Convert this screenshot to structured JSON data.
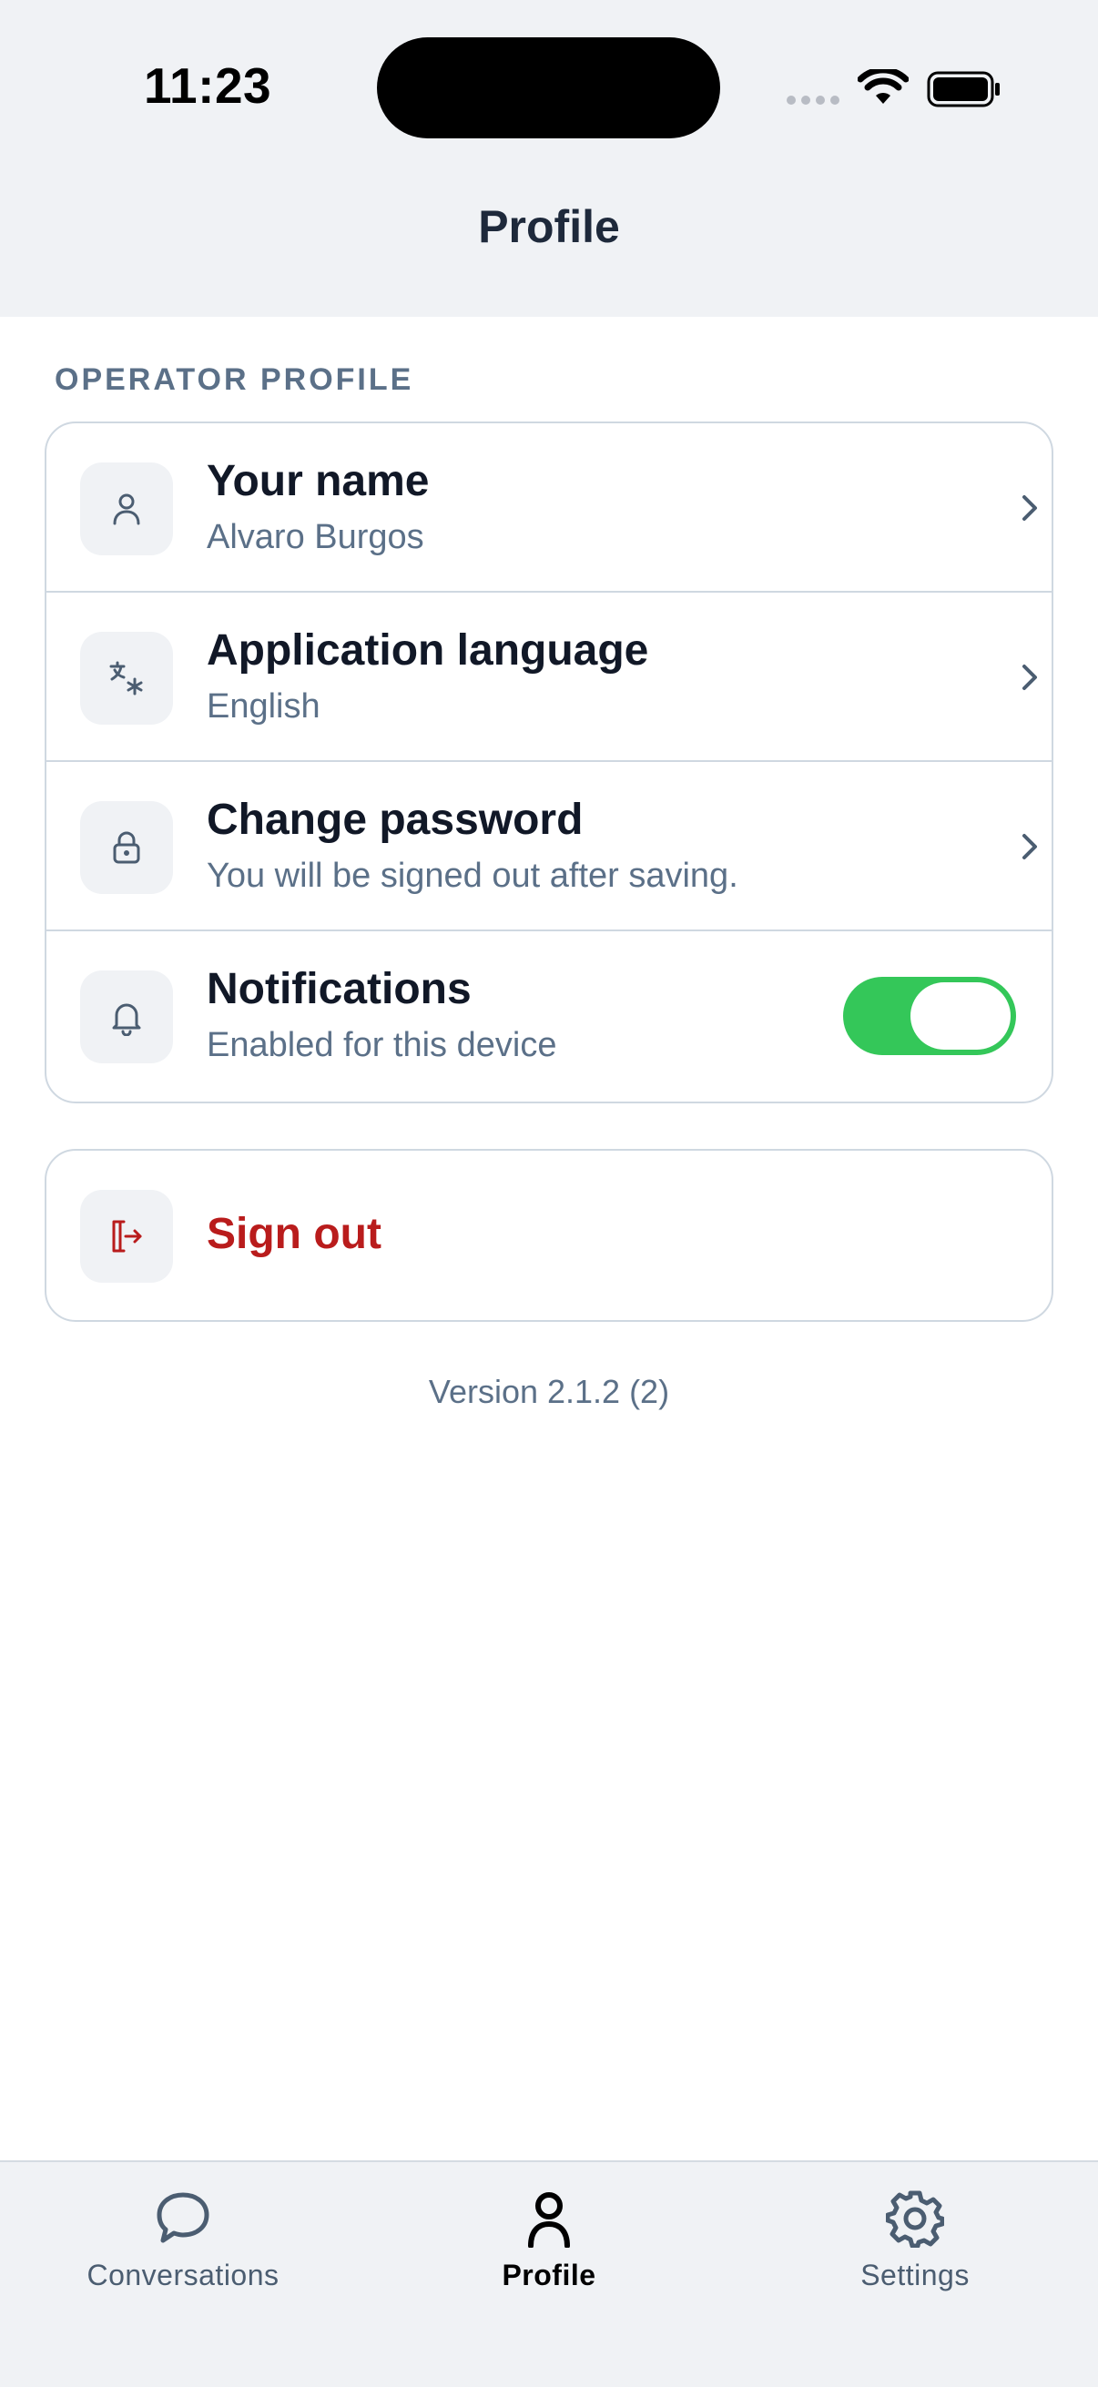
{
  "status_bar": {
    "time": "11:23",
    "icons": [
      "cellular-signal-icon",
      "wifi-icon",
      "battery-icon"
    ]
  },
  "header": {
    "title": "Profile"
  },
  "operator_profile": {
    "section_label": "OPERATOR PROFILE",
    "rows": [
      {
        "title": "Your name",
        "subtitle": "Alvaro Burgos",
        "icon": "person-icon",
        "control": "chevron"
      },
      {
        "title": "Application language",
        "subtitle": "English",
        "icon": "translate-icon",
        "control": "chevron"
      },
      {
        "title": "Change password",
        "subtitle": "You will be signed out after saving.",
        "icon": "lock-icon",
        "control": "chevron"
      },
      {
        "title": "Notifications",
        "subtitle": "Enabled for this device",
        "icon": "bell-icon",
        "control": "toggle",
        "enabled": true
      }
    ]
  },
  "sign_out": {
    "label": "Sign out",
    "icon": "sign-out-icon"
  },
  "version_text": "Version 2.1.2 (2)",
  "tabbar": {
    "tabs": [
      {
        "label": "Conversations",
        "icon": "chat-bubble-icon",
        "active": false
      },
      {
        "label": "Profile",
        "icon": "person-icon",
        "active": true
      },
      {
        "label": "Settings",
        "icon": "gear-icon",
        "active": false
      }
    ]
  },
  "colors": {
    "background": "#ffffff",
    "header_background": "#f0f2f5",
    "toggle_on": "#34c759",
    "danger": "#b91c1c",
    "muted_text": "#5b7088",
    "border": "#cfd8e1"
  }
}
